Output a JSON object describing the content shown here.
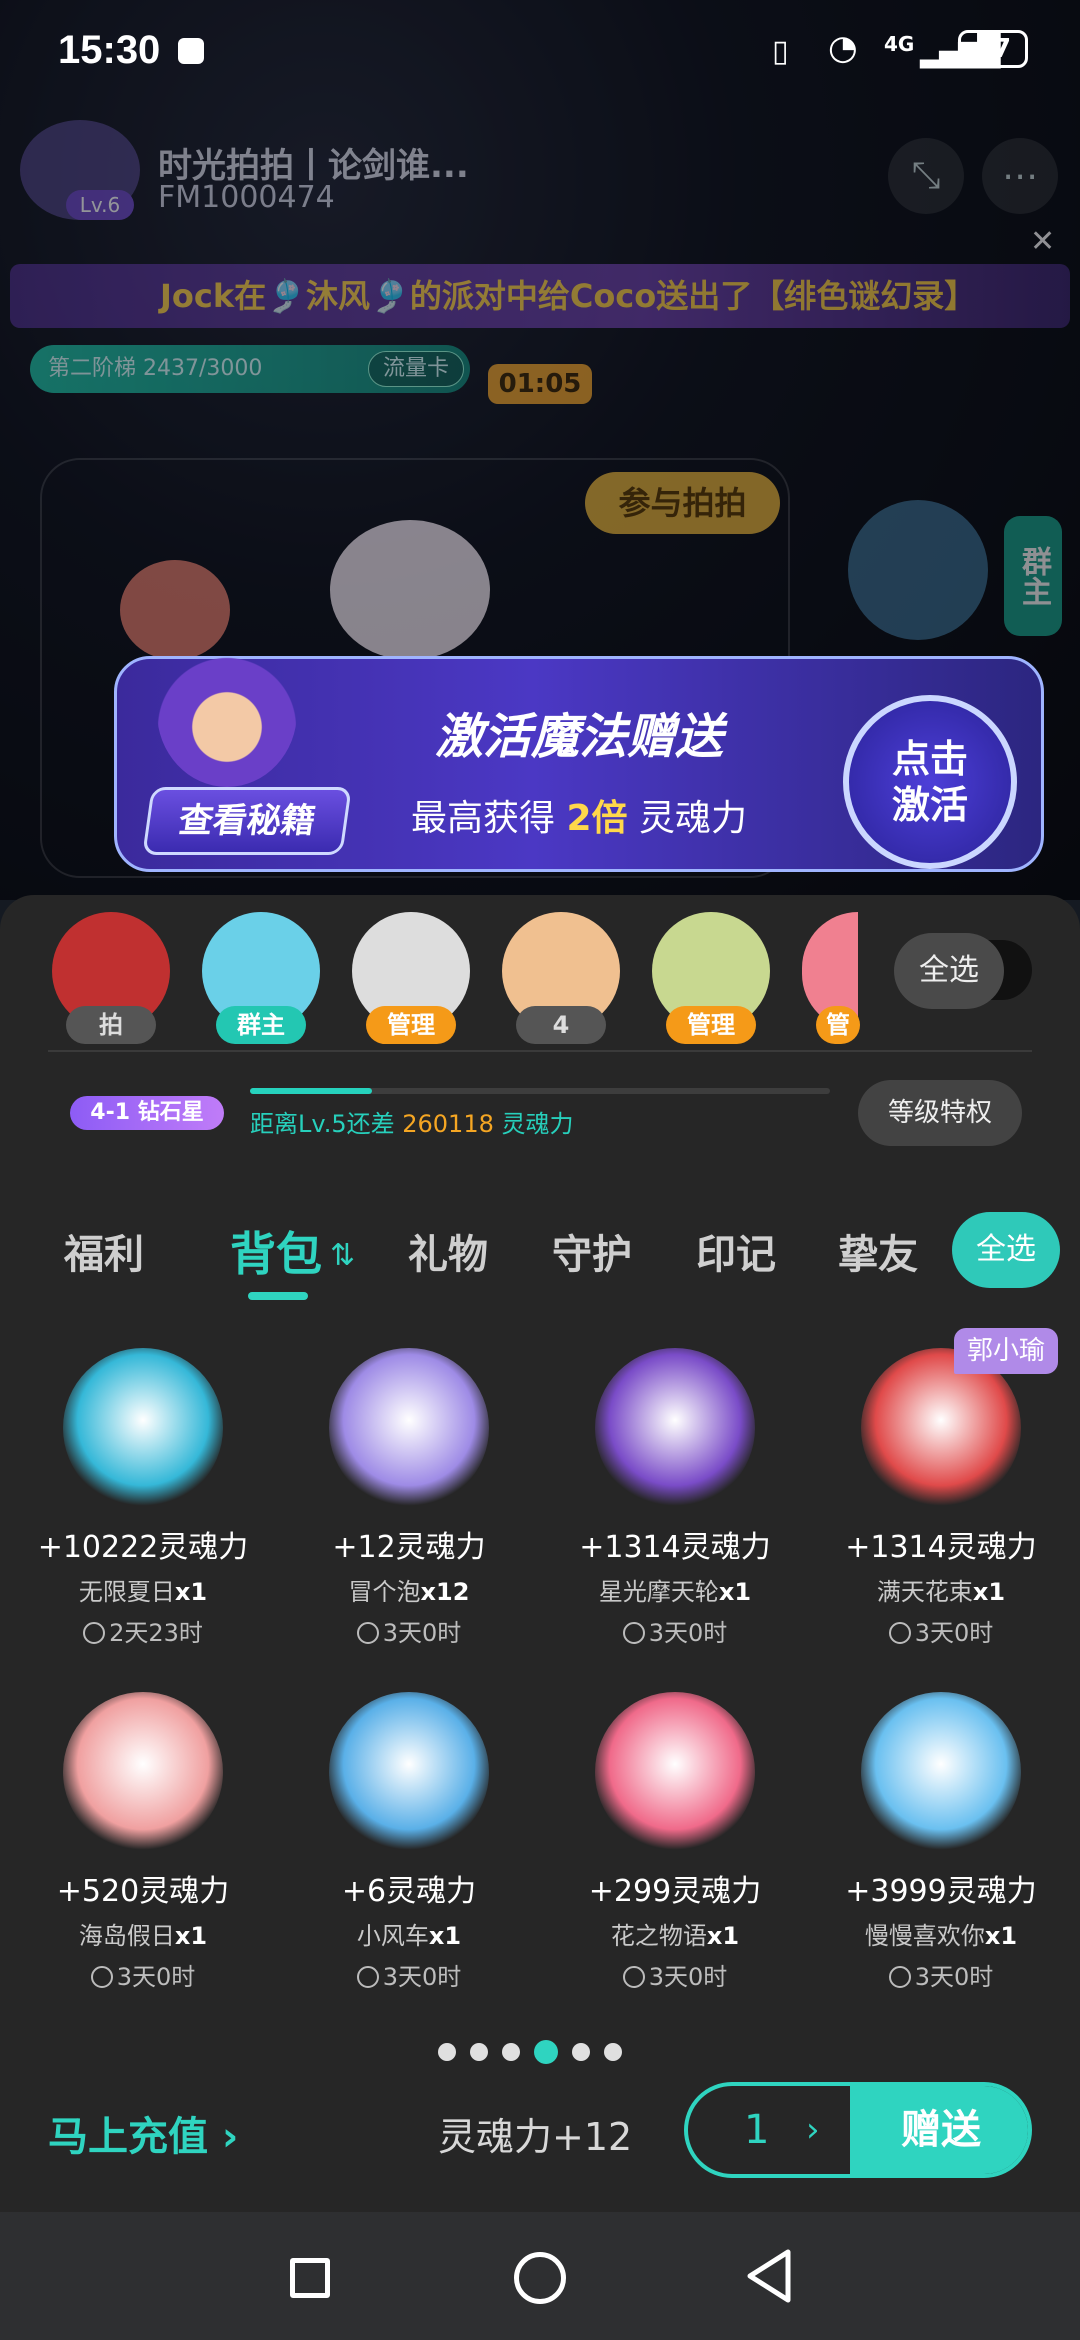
{
  "status_bar": {
    "time": "15:30",
    "battery": "67",
    "network": "4G"
  },
  "room": {
    "name": "时光拍拍丨论剑谁...",
    "id": "FM1000474",
    "level": "Lv.6",
    "banner": "Jock在🎐沐风🎐的派对中给Coco送出了【绯色谜幻录】",
    "tier": "第二阶梯 2437/3000",
    "traffic_card": "流量卡",
    "timer": "01:05",
    "join_button": "参与拍拍",
    "side_tag": "群主"
  },
  "promo": {
    "title": "激活魔法赠送",
    "subtitle_prefix": "最高获得 ",
    "subtitle_bold": "2倍",
    "subtitle_suffix": " 灵魂力",
    "secret_button": "查看秘籍",
    "activate_button_line1": "点击",
    "activate_button_line2": "激活"
  },
  "mic_users": [
    {
      "tag": "拍"
    },
    {
      "tag": "群主"
    },
    {
      "tag": "管理"
    },
    {
      "tag": "4"
    },
    {
      "tag": "管理"
    },
    {
      "tag": "管"
    }
  ],
  "select_all_top": "全选",
  "level": {
    "badge": "4-1 钻石星",
    "progress_prefix": "距离Lv.5还差 ",
    "progress_value": "260118",
    "progress_suffix": " 灵魂力",
    "progress_fraction": 0.21,
    "privilege_button": "等级特权"
  },
  "tabs": [
    "福利",
    "背包",
    "礼物",
    "守护",
    "印记",
    "挚友"
  ],
  "active_tab": "背包",
  "select_all_tab": "全选",
  "owner_badge": "郭小瑜",
  "gifts": [
    {
      "soul": "+10222灵魂力",
      "name": "无限夏日",
      "count": "x1",
      "time": "2天23时",
      "color": "#35b8d8"
    },
    {
      "soul": "+12灵魂力",
      "name": "冒个泡",
      "count": "x12",
      "time": "3天0时",
      "color": "#9e8be6"
    },
    {
      "soul": "+1314灵魂力",
      "name": "星光摩天轮",
      "count": "x1",
      "time": "3天0时",
      "color": "#7a4cc8"
    },
    {
      "soul": "+1314灵魂力",
      "name": "满天花束",
      "count": "x1",
      "time": "3天0时",
      "color": "#e04a4a"
    },
    {
      "soul": "+520灵魂力",
      "name": "海岛假日",
      "count": "x1",
      "time": "3天0时",
      "color": "#f0a0a0"
    },
    {
      "soul": "+6灵魂力",
      "name": "小风车",
      "count": "x1",
      "time": "3天0时",
      "color": "#5ab0e8"
    },
    {
      "soul": "+299灵魂力",
      "name": "花之物语",
      "count": "x1",
      "time": "3天0时",
      "color": "#f06a8a"
    },
    {
      "soul": "+3999灵魂力",
      "name": "慢慢喜欢你",
      "count": "x1",
      "time": "3天0时",
      "color": "#6ac0f0"
    }
  ],
  "pagination": {
    "total": 6,
    "active": 4
  },
  "bottom": {
    "recharge": "马上充值 ›",
    "soul_total": "灵魂力+12",
    "quantity": "1",
    "send_button": "赠送"
  }
}
